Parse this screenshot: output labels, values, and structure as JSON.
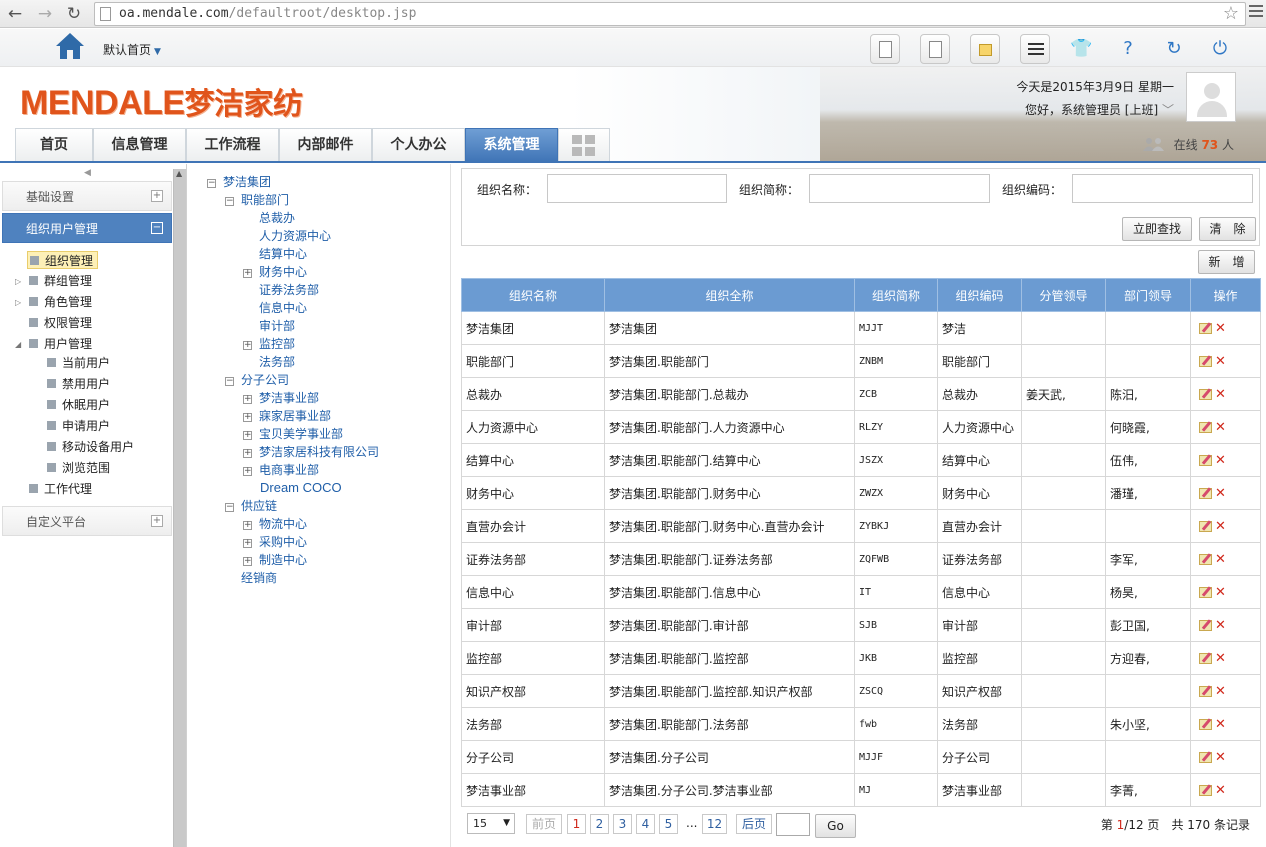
{
  "browser": {
    "url_host": "oa.mendale.com",
    "url_path": "/defaultroot/desktop.jsp"
  },
  "header": {
    "home_label": "默认首页",
    "logo_latin": "MENDALE",
    "logo_cn": "梦洁家纺",
    "date_text": "今天是2015年3月9日 星期一",
    "greeting": "您好，系统管理员 [上班]",
    "online_prefix": "在线",
    "online_count": "73",
    "online_suffix": "人"
  },
  "tabs": [
    "首页",
    "信息管理",
    "工作流程",
    "内部邮件",
    "个人办公",
    "系统管理"
  ],
  "left_menu": {
    "group_basic": "基础设置",
    "group_org_user": "组织用户管理",
    "items": [
      "组织管理",
      "群组管理",
      "角色管理",
      "权限管理",
      "用户管理"
    ],
    "user_sub": [
      "当前用户",
      "禁用用户",
      "休眠用户",
      "申请用户",
      "移动设备用户",
      "浏览范围"
    ],
    "work_proxy": "工作代理",
    "group_custom": "自定义平台"
  },
  "tree": {
    "root": "梦洁集团",
    "functional": "职能部门",
    "functional_children": [
      "总裁办",
      "人力资源中心",
      "结算中心",
      "财务中心",
      "证券法务部",
      "信息中心",
      "审计部",
      "监控部",
      "法务部"
    ],
    "subsidiary": "分子公司",
    "subsidiary_children": [
      "梦洁事业部",
      "寐家居事业部",
      "宝贝美学事业部",
      "梦洁家居科技有限公司",
      "电商事业部",
      "Dream COCO"
    ],
    "supply": "供应链",
    "supply_children": [
      "物流中心",
      "采购中心",
      "制造中心"
    ],
    "dealer": "经销商"
  },
  "search": {
    "name_label": "组织名称：",
    "short_label": "组织简称：",
    "code_label": "组织编码：",
    "search_button": "立即查找",
    "clear_button": "清　除",
    "add_button": "新　增"
  },
  "table": {
    "headers": [
      "组织名称",
      "组织全称",
      "组织简称",
      "组织编码",
      "分管领导",
      "部门领导",
      "操作"
    ],
    "rows": [
      [
        "梦洁集团",
        "梦洁集团",
        "MJJT",
        "梦洁",
        "",
        ""
      ],
      [
        "职能部门",
        "梦洁集团.职能部门",
        "ZNBM",
        "职能部门",
        "",
        ""
      ],
      [
        "总裁办",
        "梦洁集团.职能部门.总裁办",
        "ZCB",
        "总裁办",
        "姜天武,",
        "陈汨,"
      ],
      [
        "人力资源中心",
        "梦洁集团.职能部门.人力资源中心",
        "RLZY",
        "人力资源中心",
        "",
        "何晓霞,"
      ],
      [
        "结算中心",
        "梦洁集团.职能部门.结算中心",
        "JSZX",
        "结算中心",
        "",
        "伍伟,"
      ],
      [
        "财务中心",
        "梦洁集团.职能部门.财务中心",
        "ZWZX",
        "财务中心",
        "",
        "潘瑾,"
      ],
      [
        "直营办会计",
        "梦洁集团.职能部门.财务中心.直营办会计",
        "ZYBKJ",
        "直营办会计",
        "",
        ""
      ],
      [
        "证券法务部",
        "梦洁集团.职能部门.证券法务部",
        "ZQFWB",
        "证券法务部",
        "",
        "李军,"
      ],
      [
        "信息中心",
        "梦洁集团.职能部门.信息中心",
        "IT",
        "信息中心",
        "",
        "杨昊,"
      ],
      [
        "审计部",
        "梦洁集团.职能部门.审计部",
        "SJB",
        "审计部",
        "",
        "彭卫国,"
      ],
      [
        "监控部",
        "梦洁集团.职能部门.监控部",
        "JKB",
        "监控部",
        "",
        "方迎春,"
      ],
      [
        "知识产权部",
        "梦洁集团.职能部门.监控部.知识产权部",
        "ZSCQ",
        "知识产权部",
        "",
        ""
      ],
      [
        "法务部",
        "梦洁集团.职能部门.法务部",
        "fwb",
        "法务部",
        "",
        "朱小坚,"
      ],
      [
        "分子公司",
        "梦洁集团.分子公司",
        "MJJF",
        "分子公司",
        "",
        ""
      ],
      [
        "梦洁事业部",
        "梦洁集团.分子公司.梦洁事业部",
        "MJ",
        "梦洁事业部",
        "",
        "李菁,"
      ]
    ]
  },
  "pager": {
    "page_size": "15",
    "prev": "前页",
    "pages": [
      "1",
      "2",
      "3",
      "4",
      "5"
    ],
    "ellipsis": "...",
    "last_page": "12",
    "next": "后页",
    "go": "Go",
    "info_prefix": "第",
    "current": "1",
    "info_total_pages": "/12 页",
    "info_records": "共 170 条记录"
  },
  "colors": {
    "accent": "#3f74b6",
    "table_header": "#6b9bd2",
    "logo": "#e0541b",
    "delete": "#d0281b"
  }
}
